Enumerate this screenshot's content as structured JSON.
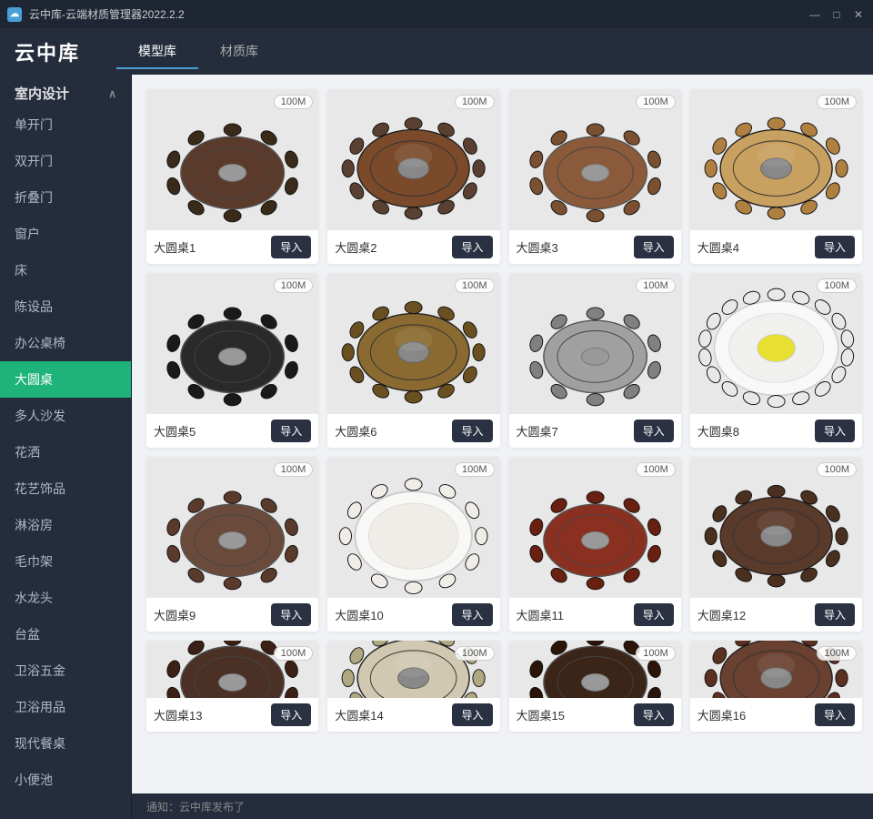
{
  "titlebar": {
    "title": "云中库-云端材质管理器2022.2.2",
    "icon": "☁",
    "minimize": "—",
    "maximize": "□",
    "close": "✕"
  },
  "nav": {
    "logo": "云中库",
    "tabs": [
      "模型库",
      "材质库"
    ]
  },
  "sidebar": {
    "section": "室内设计",
    "items": [
      "单开门",
      "双开门",
      "折叠门",
      "窗户",
      "床",
      "陈设品",
      "办公桌椅",
      "大圆桌",
      "多人沙发",
      "花洒",
      "花艺饰品",
      "淋浴房",
      "毛巾架",
      "水龙头",
      "台盆",
      "卫浴五金",
      "卫浴用品",
      "现代餐桌",
      "小便池"
    ],
    "active_item": "大圆桌"
  },
  "grid": {
    "badge": "100M",
    "items": [
      {
        "name": "大圆桌1",
        "id": 1
      },
      {
        "name": "大圆桌2",
        "id": 2
      },
      {
        "name": "大圆桌3",
        "id": 3
      },
      {
        "name": "大圆桌4",
        "id": 4
      },
      {
        "name": "大圆桌5",
        "id": 5
      },
      {
        "name": "大圆桌6",
        "id": 6
      },
      {
        "name": "大圆桌7",
        "id": 7
      },
      {
        "name": "大圆桌8",
        "id": 8
      },
      {
        "name": "大圆桌9",
        "id": 9
      },
      {
        "name": "大圆桌10",
        "id": 10
      },
      {
        "name": "大圆桌11",
        "id": 11
      },
      {
        "name": "大圆桌12",
        "id": 12
      },
      {
        "name": "大圆桌13",
        "id": 13
      },
      {
        "name": "大圆桌14",
        "id": 14
      },
      {
        "name": "大圆桌15",
        "id": 15
      },
      {
        "name": "大圆桌16",
        "id": 16
      }
    ],
    "import_label": "导入"
  },
  "statusbar": {
    "notice": "通知：云中库发布了"
  },
  "colors": {
    "tables": [
      "#5a3a2a",
      "#7a4a2a",
      "#8b5a3a",
      "#c8a060",
      "#2a2a2a",
      "#8a6a30",
      "#a0a0a0",
      "#e8e8e8",
      "#6a4a3a",
      "#f0f0ee",
      "#8a3020",
      "#5a3a2a",
      "#4a3025",
      "#d0c8b0",
      "#3a2518",
      "#6a4030"
    ],
    "chair_colors": [
      "#3a2a1a",
      "#5a4030",
      "#7a5030",
      "#b08040",
      "#1a1a1a",
      "#6a5020",
      "#808080",
      "#c0c0c0",
      "#5a3a2a",
      "#e0d8c0",
      "#6a2010",
      "#4a3020",
      "#3a2015",
      "#b0a880",
      "#2a1508",
      "#5a3020"
    ]
  }
}
